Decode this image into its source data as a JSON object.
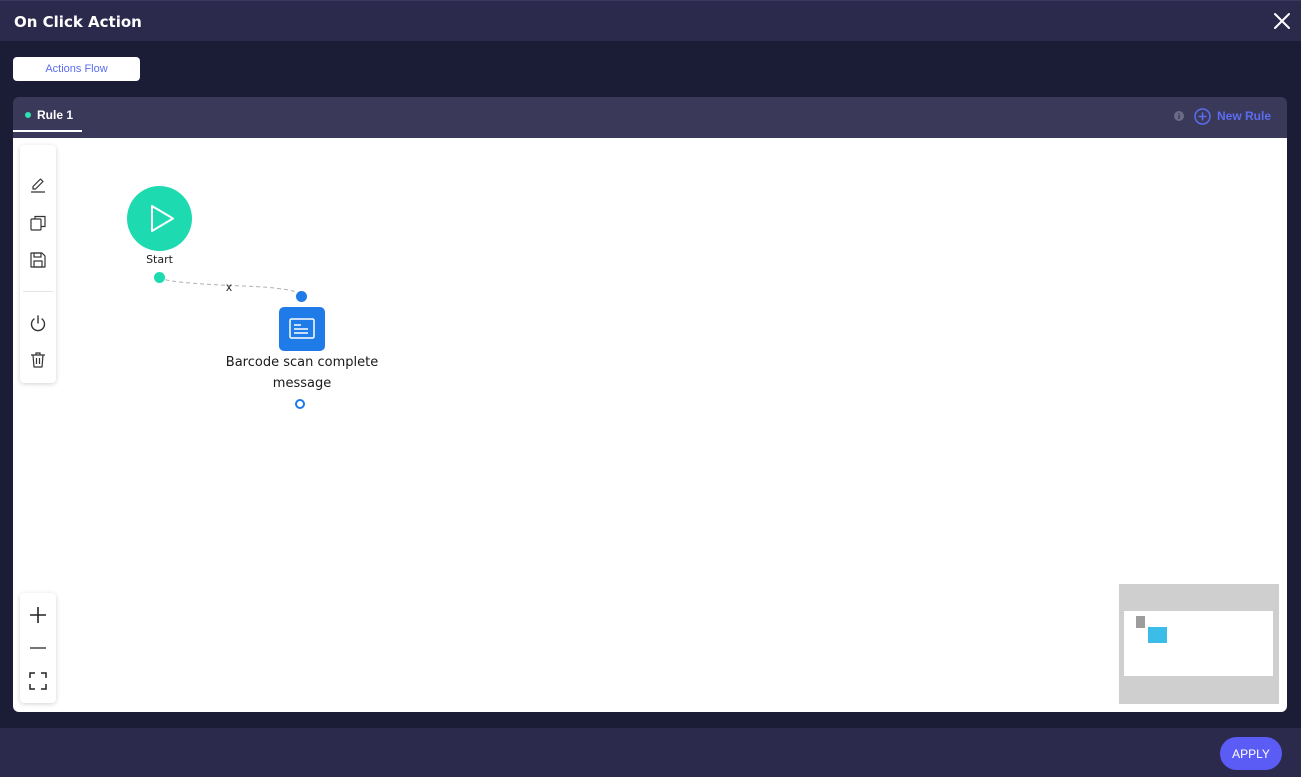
{
  "dialog": {
    "title": "On Click Action",
    "close_icon": "close-icon"
  },
  "tabs": {
    "actions_flow": "Actions Flow"
  },
  "rules": {
    "items": [
      {
        "label": "Rule 1",
        "active": true,
        "status_color": "#2ee0b4"
      }
    ],
    "info_icon": "info-icon",
    "new_rule": "New Rule"
  },
  "toolbar": {
    "tools": [
      "edit-icon",
      "copy-icon",
      "save-icon",
      "power-icon",
      "delete-icon"
    ],
    "zoom": [
      "zoom-in-icon",
      "zoom-out-icon",
      "fit-screen-icon"
    ]
  },
  "flow": {
    "start": {
      "label": "Start",
      "color": "#1edab1"
    },
    "edge_remove": "x",
    "action": {
      "label": "Barcode scan complete message",
      "color": "#1f7be8",
      "icon": "message-icon"
    }
  },
  "footer": {
    "apply": "APPLY"
  },
  "colors": {
    "accent": "#5b6cf0",
    "background": "#1b1d36",
    "panel": "#2b2a4c"
  }
}
